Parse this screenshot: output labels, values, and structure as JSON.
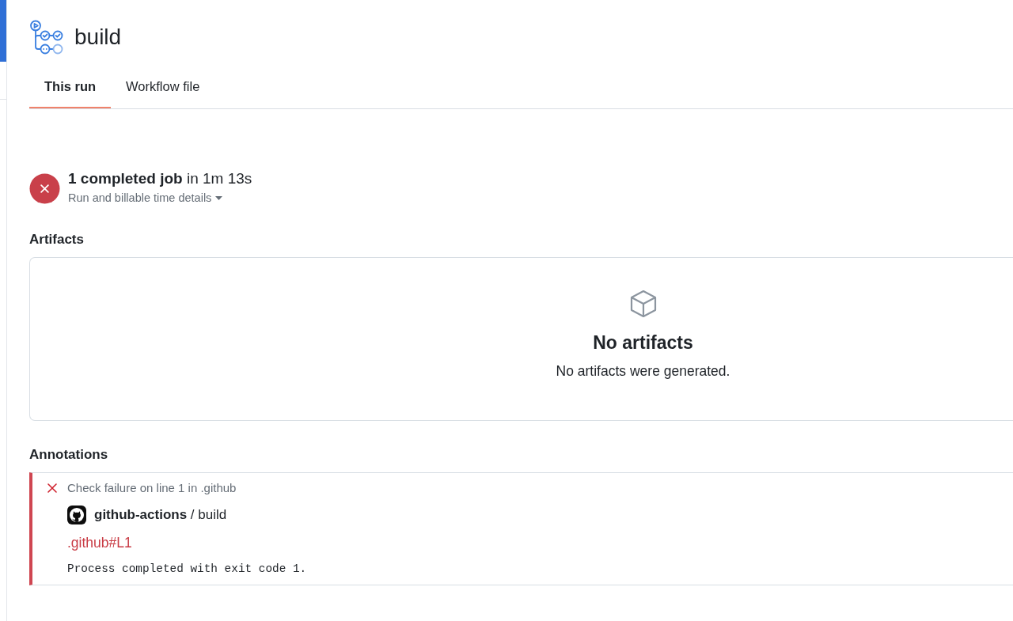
{
  "header": {
    "title": "build"
  },
  "tabs": [
    {
      "label": "This run",
      "selected": true
    },
    {
      "label": "Workflow file",
      "selected": false
    }
  ],
  "run_summary": {
    "failed": true,
    "headline": "**1 completed job** in 1m 13s",
    "details_label": "Run and billable time details",
    "details_expanded": false
  },
  "artifacts": {
    "heading": "Artifacts",
    "empty_title": "No artifacts",
    "empty_text": "No artifacts were generated."
  },
  "annotations": {
    "heading": "Annotations",
    "items": [
      {
        "failed": true,
        "title": "Check failure on line 1 in .github",
        "source": "**github-actions** / build",
        "location": ".github#L1",
        "message": "Process completed with exit code 1."
      }
    ]
  }
}
